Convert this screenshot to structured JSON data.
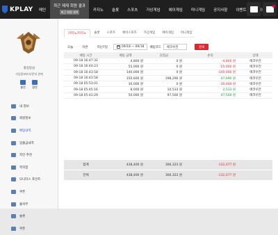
{
  "brand": {
    "name": "KPLAY"
  },
  "nav": [
    {
      "label": "메인"
    },
    {
      "label": "최근 제재 회원 결과",
      "sub": "최근 회원 내역",
      "active": true
    },
    {
      "label": "카지노"
    },
    {
      "label": "슬롯"
    },
    {
      "label": "스포츠"
    },
    {
      "label": "가상게임"
    },
    {
      "label": "에이게임"
    },
    {
      "label": "미니게임"
    },
    {
      "label": "공지사항"
    },
    {
      "label": "이벤트"
    },
    {
      "label": "고객센터"
    }
  ],
  "top_icons": [
    "chat-icon",
    "notice-icon"
  ],
  "user": {
    "name": "홍길동님",
    "id": "가입정보보기/문의 관계"
  },
  "quick": [
    {
      "label": "충전",
      "icon": "deposit-icon"
    },
    {
      "label": "환전",
      "icon": "withdraw-icon"
    }
  ],
  "side_menu": [
    {
      "label": "내 정보",
      "icon": "user-icon"
    },
    {
      "label": "회원정보",
      "icon": "profile-icon"
    },
    {
      "label": "배팅내역",
      "icon": "bet-icon",
      "active": true
    },
    {
      "label": "입출금내역",
      "icon": "money-icon"
    },
    {
      "label": "지인 추천",
      "icon": "refer-icon"
    },
    {
      "label": "쪽지함",
      "icon": "message-icon"
    },
    {
      "label": "모니터스 포인트",
      "icon": "point-icon"
    },
    {
      "label": "쿠폰",
      "icon": "coupon-icon"
    },
    {
      "label": "출석부",
      "icon": "attendance-icon"
    },
    {
      "label": "슬롯",
      "icon": "slot-icon"
    },
    {
      "label": "쿠폰",
      "icon": "coupon-icon-2"
    }
  ],
  "tabs": [
    {
      "label": "카지노/카지노",
      "active": true
    },
    {
      "label": "슬롯"
    },
    {
      "label": "스포츠"
    },
    {
      "label": "에이스포츠"
    },
    {
      "label": "가상게임"
    },
    {
      "label": "에이게임"
    },
    {
      "label": "미니게임"
    }
  ],
  "filter": {
    "today": "오늘",
    "week": "이번",
    "last7": "지난7일",
    "date_range": "09/18 ~ 09/18",
    "type": "베팅코드",
    "type_value": "에코우전",
    "search": "검색"
  },
  "table": {
    "headers": [
      "베팅 시간",
      "베팅 금액",
      "당첨금",
      "손익",
      "상태"
    ],
    "rows": [
      {
        "time": "09-18 16:47:32",
        "bet": "4,800 원",
        "win": "0 원",
        "pl": "-4,800 원",
        "pl_sign": "neg",
        "status": "에코우전"
      },
      {
        "time": "09-18 16:44:23",
        "bet": "55,000 원",
        "win": "0 원",
        "pl": "-55,000 원",
        "pl_sign": "neg",
        "status": "에코우전"
      },
      {
        "time": "09-18 16:43:58",
        "bet": "140,000 원",
        "win": "0 원",
        "pl": "-140,000 원",
        "pl_sign": "neg",
        "status": "에코우전"
      },
      {
        "time": "09-18 16:43:58",
        "bet": "150,600 원",
        "win": "198,290 원",
        "pl": "47,690 원",
        "pl_sign": "pos",
        "status": "에코우전"
      },
      {
        "time": "09-18 05:53:01",
        "bet": "30,000 원",
        "win": "0 원",
        "pl": "-30,000 원",
        "pl_sign": "neg",
        "status": "에코우전"
      },
      {
        "time": "09-18 05:45:16",
        "bet": "8,000 원",
        "win": "10,533 원",
        "pl": "2,533 원",
        "pl_sign": "pos",
        "status": "에코우전"
      },
      {
        "time": "09-18 05:43:29",
        "bet": "50,000 원",
        "win": "97,500 원",
        "pl": "47,500 원",
        "pl_sign": "pos",
        "status": "에코우전"
      }
    ]
  },
  "totals": [
    {
      "label": "합계",
      "bet": "438,400 원",
      "win": "306,323 원",
      "pl": "-132,077 원"
    },
    {
      "label": "전체",
      "bet": "438,400 원",
      "win": "306,323 원",
      "pl": "-132,077 원"
    }
  ]
}
